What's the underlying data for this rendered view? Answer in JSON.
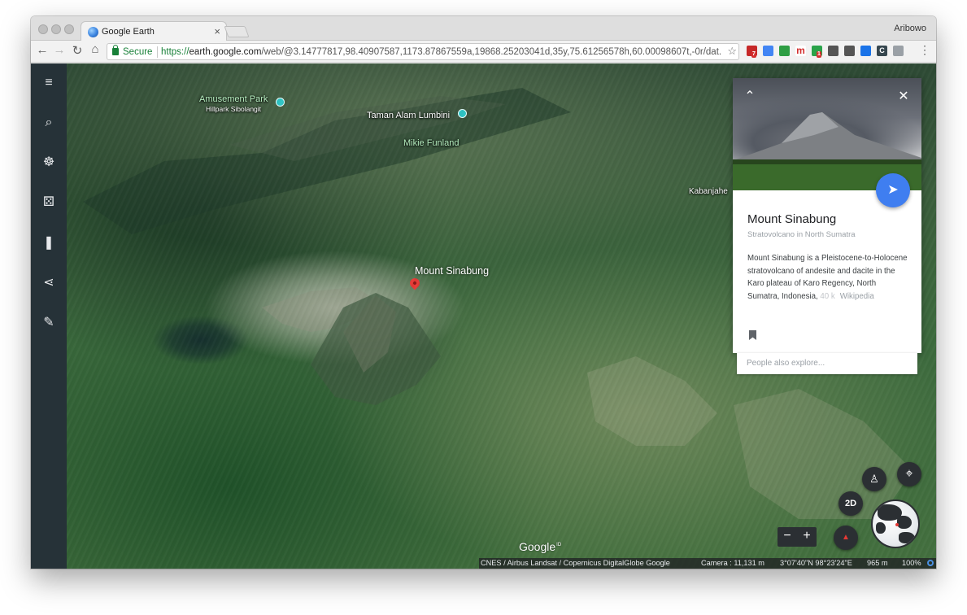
{
  "browser": {
    "tab_title": "Google Earth",
    "tab_close": "×",
    "profile_name": "Aribowo",
    "secure_label": "Secure",
    "url_scheme": "https://",
    "url_host": "earth.google.com",
    "url_rest": "/web/@3.14777817,98.40907587,1173.87867559a,19868.25203041d,35y,75.61256578h,60.00098607t,-0r/dat...",
    "nav": {
      "back": "←",
      "forward": "→",
      "reload": "↻",
      "home": "⌂"
    },
    "bookmark_star": "☆",
    "menu_dots": "⋮",
    "extensions": [
      {
        "name": "lastpass-ext-icon",
        "color": "#c62828",
        "label": "",
        "badge": "7"
      },
      {
        "name": "translate-ext-icon",
        "color": "#4285f4",
        "label": ""
      },
      {
        "name": "download-ext-icon",
        "color": "#2e9e44",
        "label": ""
      },
      {
        "name": "m-ext-icon",
        "color": "#ffffff",
        "label": "m"
      },
      {
        "name": "grammarly-ext-icon",
        "color": "#2aa34a",
        "label": "",
        "badge": "1"
      },
      {
        "name": "wappalyzer-ext-icon",
        "color": "#555555",
        "label": ""
      },
      {
        "name": "pocket-ext-icon",
        "color": "#555555",
        "label": ""
      },
      {
        "name": "eye-ext-icon",
        "color": "#1a73e8",
        "label": ""
      },
      {
        "name": "clipper-ext-icon",
        "color": "#37474f",
        "label": "C"
      },
      {
        "name": "vuetify-ext-icon",
        "color": "#9aa0a6",
        "label": ""
      }
    ]
  },
  "sidebar": {
    "items": [
      {
        "name": "menu",
        "icon": "≡"
      },
      {
        "name": "search",
        "icon": "⌕"
      },
      {
        "name": "voyager",
        "icon": "☸"
      },
      {
        "name": "feeling-lucky",
        "icon": "⚄"
      },
      {
        "name": "projects",
        "icon": "❚"
      },
      {
        "name": "share",
        "icon": "⋖"
      },
      {
        "name": "measure",
        "icon": "✎"
      }
    ]
  },
  "map": {
    "places": [
      {
        "name": "Amusement Park",
        "style": "green"
      },
      {
        "name": "Hillpark Sibolangit",
        "style": "small"
      },
      {
        "name": "Taman Alam Lumbini",
        "style": "white"
      },
      {
        "name": "Mikie Funland",
        "style": "green"
      },
      {
        "name": "Kabanjahe",
        "style": "small"
      }
    ],
    "pin_label": "Mount Sinabung"
  },
  "card": {
    "up_icon": "⌃",
    "close_icon": "✕",
    "fab_icon": "➤",
    "title": "Mount Sinabung",
    "subtitle": "Stratovolcano in North Sumatra",
    "description": "Mount Sinabung is a Pleistocene-to-Holocene stratovolcano of andesite and dacite in the Karo plateau of Karo Regency, North Sumatra, Indonesia,",
    "description_faded": "40 k",
    "source_link": "Wikipedia",
    "explore_placeholder": "People also explore..."
  },
  "controls": {
    "pegman_icon": "♙",
    "location_icon": "⌖",
    "mode_2d": "2D",
    "zoom_out": "−",
    "zoom_in": "+",
    "compass_icon": "▲"
  },
  "attribution": {
    "logo": "Google",
    "logo_sup": "ID",
    "credits": "CNES / Airbus  Landsat / Copernicus  DigitalGlobe  Google",
    "camera": "Camera :  11,131 m",
    "coords": "3°07'40\"N 98°23'24\"E",
    "altitude": "965 m",
    "zoom_pct": "100%"
  }
}
